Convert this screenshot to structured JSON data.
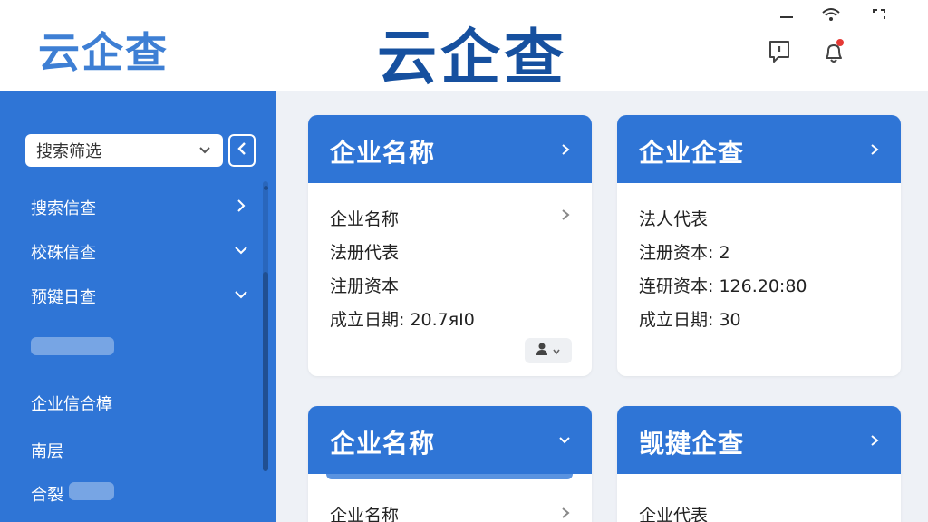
{
  "header": {
    "logo_text": "云企查",
    "brand_text": "云企查",
    "window_controls": [
      "minimize",
      "wifi",
      "restore"
    ],
    "icons": [
      "feedback-icon",
      "notification-bell-icon"
    ],
    "notification_dot_color": "#e53935"
  },
  "sidebar": {
    "filter": {
      "label": "搜索筛选",
      "icon": "chevron-down-icon"
    },
    "collapse_icon": "chevron-left-icon",
    "items": [
      {
        "label": "搜索信查",
        "icon": "chevron-right-icon"
      },
      {
        "label": "校硃信查",
        "icon": "chevron-down-icon"
      },
      {
        "label": "预键日查",
        "icon": "chevron-down-icon"
      },
      {
        "label": "企业信合樟"
      },
      {
        "label": "南层"
      },
      {
        "label": "合裂"
      }
    ]
  },
  "cards": [
    {
      "title": "企业名称",
      "header_icon": "chevron-right-icon",
      "fields": [
        "企业名称",
        "法册代表",
        "注册资本",
        "成立日期: 20.7яI0"
      ],
      "row_icon": "chevron-right-icon",
      "chip_icon": "user-icon"
    },
    {
      "title": "企业企查",
      "header_icon": "chevron-right-icon",
      "fields": [
        "法人代表",
        "注册资本: 2",
        "连研资本: 126.20:80",
        "成立日期: 30"
      ]
    },
    {
      "title": "企业名称",
      "header_icon": "chevron-down-icon",
      "fields": [
        "企业名称"
      ],
      "row_icon": "chevron-right-icon"
    },
    {
      "title": "觊揵企查",
      "header_icon": "chevron-right-icon",
      "fields": [
        "企业代表"
      ]
    }
  ],
  "colors": {
    "primary": "#2f75d6",
    "logo": "#3e7fd4",
    "brand": "#16509f",
    "background": "#eef1f6"
  }
}
